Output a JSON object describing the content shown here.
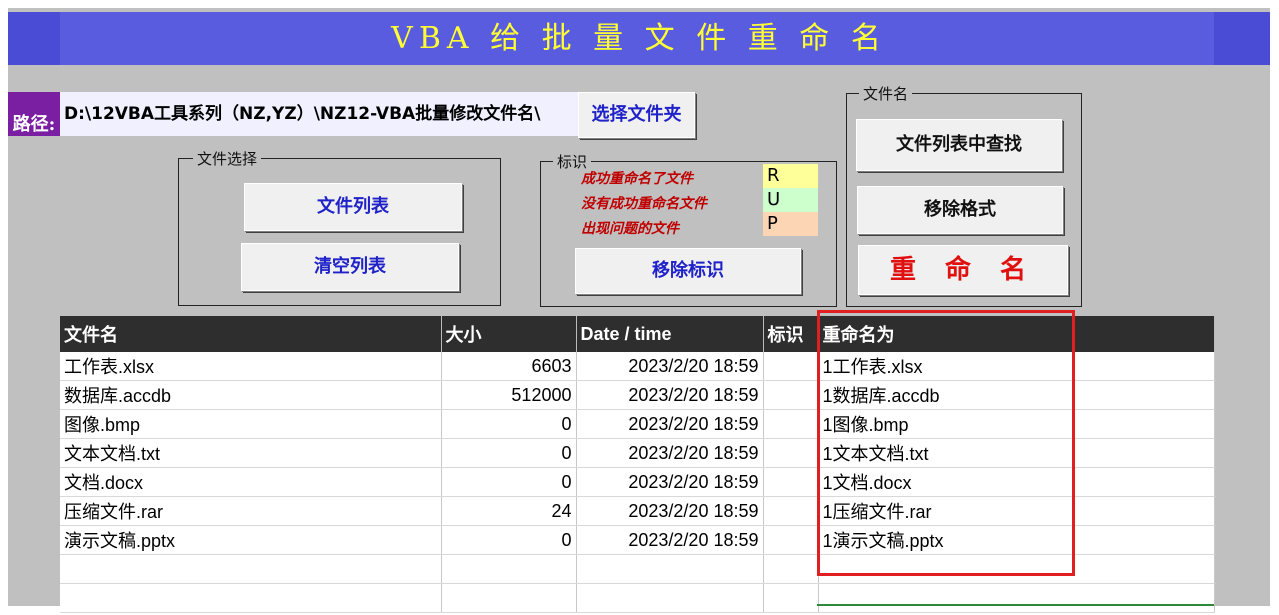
{
  "title": "VBA 给 批 量 文 件 重 命 名",
  "path": {
    "label": "路径:",
    "value": "D:\\12VBA工具系列（NZ,YZ）\\NZ12-VBA批量修改文件名\\"
  },
  "buttons": {
    "select_folder": "选择文件夹",
    "file_list": "文件列表",
    "clear_list": "清空列表",
    "remove_marks": "移除标识",
    "find_in_list": "文件列表中查找",
    "remove_format": "移除格式",
    "rename": "重 命 名"
  },
  "groups": {
    "file_select": "文件选择",
    "marks": "标识",
    "filename": "文件名"
  },
  "legend": [
    {
      "text": "成功重命名了文件",
      "code": "R",
      "color": "#ffff99"
    },
    {
      "text": "没有成功重命名文件",
      "code": "U",
      "color": "#ccffcc"
    },
    {
      "text": "出现问题的文件",
      "code": "P",
      "color": "#fcd5b4"
    }
  ],
  "table": {
    "headers": [
      "文件名",
      "大小",
      "Date / time",
      "标识",
      "重命名为"
    ],
    "rows": [
      [
        "工作表.xlsx",
        "6603",
        "2023/2/20 18:59",
        "",
        "1工作表.xlsx"
      ],
      [
        "数据库.accdb",
        "512000",
        "2023/2/20 18:59",
        "",
        "1数据库.accdb"
      ],
      [
        "图像.bmp",
        "0",
        "2023/2/20 18:59",
        "",
        "1图像.bmp"
      ],
      [
        "文本文档.txt",
        "0",
        "2023/2/20 18:59",
        "",
        "1文本文档.txt"
      ],
      [
        "文档.docx",
        "0",
        "2023/2/20 18:59",
        "",
        "1文档.docx"
      ],
      [
        "压缩文件.rar",
        "24",
        "2023/2/20 18:59",
        "",
        "1压缩文件.rar"
      ],
      [
        "演示文稿.pptx",
        "0",
        "2023/2/20 18:59",
        "",
        "1演示文稿.pptx"
      ],
      [
        "",
        "",
        "",
        "",
        ""
      ],
      [
        "",
        "",
        "",
        "",
        ""
      ]
    ]
  },
  "colors": {
    "title_bg": "#5a5ce0",
    "title_text": "#ffff33",
    "header_bg": "#2e2e2e",
    "highlight": "#e02020"
  }
}
